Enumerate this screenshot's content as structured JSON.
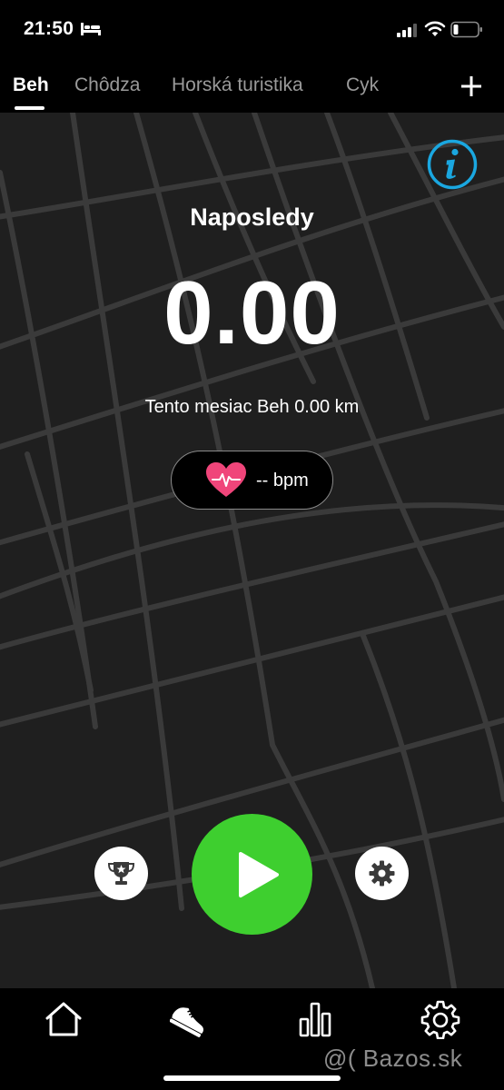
{
  "status": {
    "time": "21:50"
  },
  "tabs": [
    {
      "label": "Beh",
      "active": true
    },
    {
      "label": "Chôdza",
      "active": false
    },
    {
      "label": "Horská turistika",
      "active": false
    },
    {
      "label": "Cyk",
      "active": false
    }
  ],
  "main": {
    "last_label": "Naposledy",
    "last_value": "0.00",
    "month_summary": "Tento mesiac Beh 0.00 km",
    "heart_rate": "-- bpm"
  },
  "icons": {
    "status": [
      "bed-icon",
      "signal-icon",
      "wifi-icon",
      "battery-icon"
    ],
    "tabs": [
      "add-icon"
    ],
    "main": [
      "info-icon",
      "heart-icon"
    ],
    "controls": [
      "trophy-icon",
      "play-icon",
      "gear-icon"
    ],
    "nav": [
      "home-icon",
      "shoe-icon",
      "bar-chart-icon",
      "settings-gear-icon"
    ]
  },
  "watermark": "@( Bazos.sk",
  "colors": {
    "background": "#000000",
    "map": "#1f1f1f",
    "map_lines": "#3a3a3a",
    "accent_green": "#3ecf2f",
    "info_blue": "#1aa7e0",
    "heart_pink": "#f0457a",
    "tab_inactive": "#9a9a9a"
  }
}
